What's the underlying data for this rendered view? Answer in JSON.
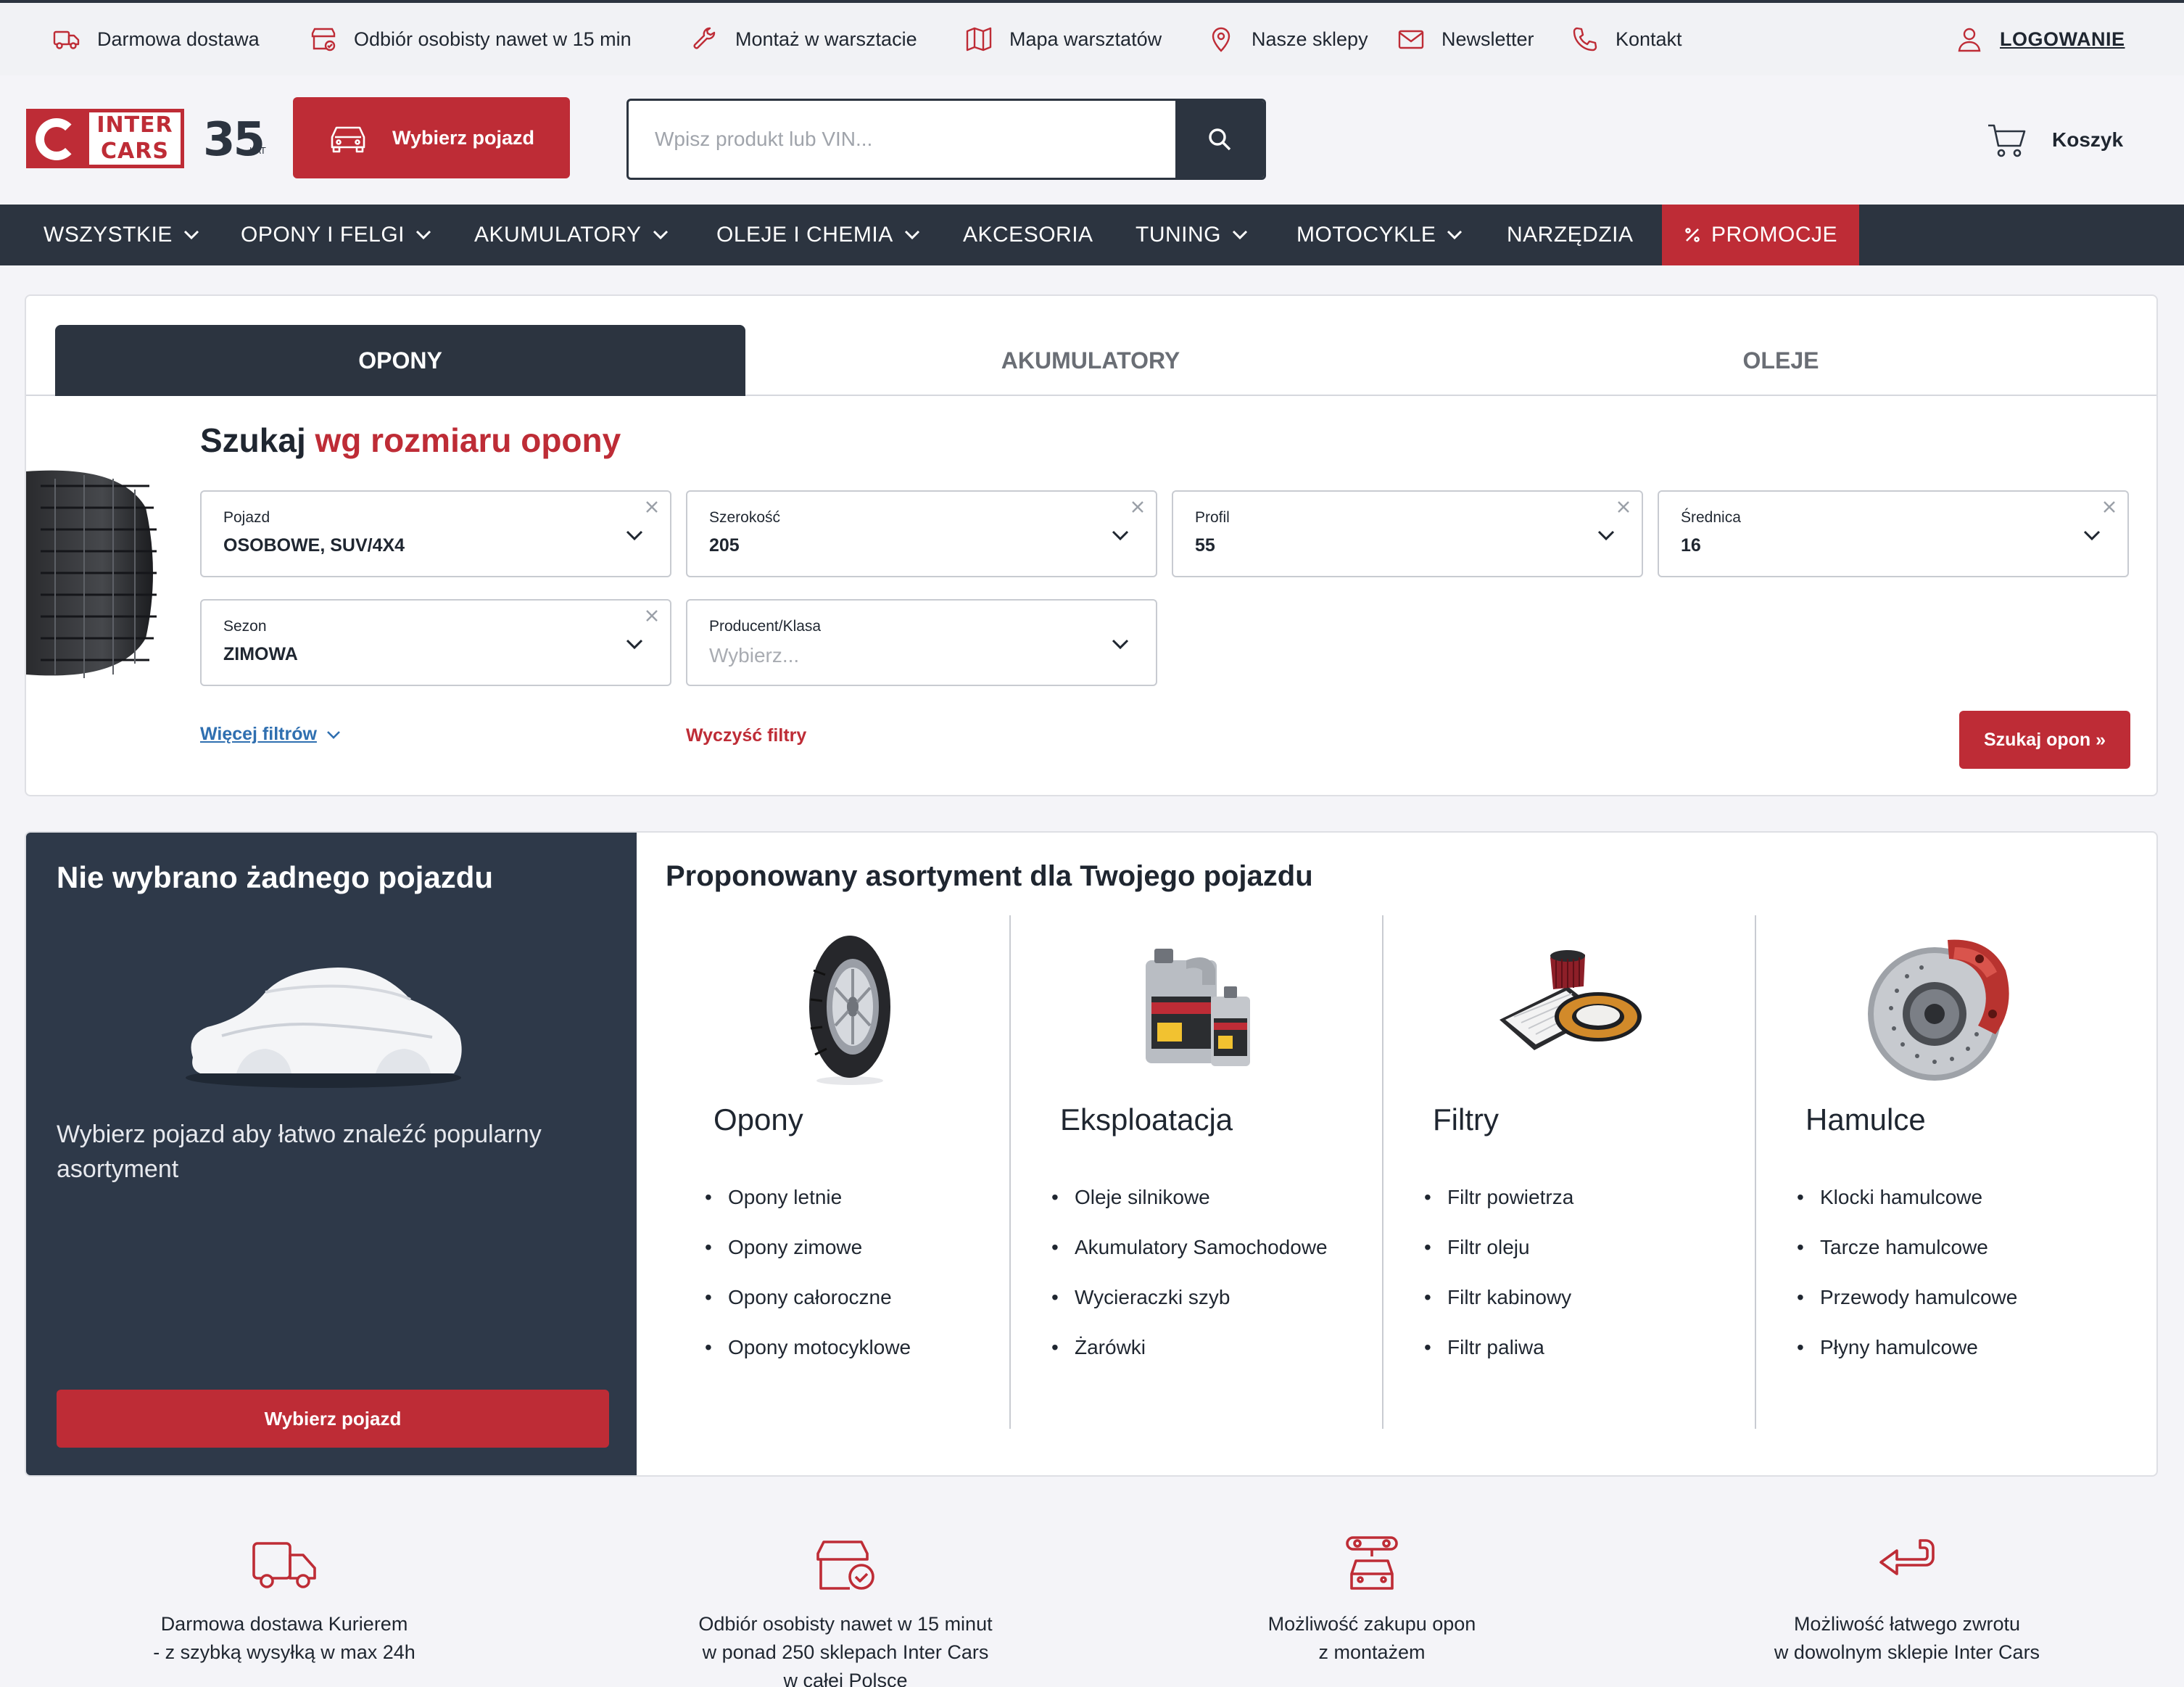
{
  "topbar": {
    "links": [
      "Darmowa dostawa",
      "Odbiór osobisty nawet w 15 min",
      "Montaż w warsztacie",
      "Mapa warsztatów",
      "Nasze sklepy",
      "Newsletter",
      "Kontakt"
    ],
    "login": "LOGOWANIE"
  },
  "header": {
    "logo_text_1": "INTER",
    "logo_text_2": "CARS",
    "anniversary": "35",
    "anniversary_suffix": "LAT",
    "choose_vehicle": "Wybierz pojazd",
    "search_placeholder": "Wpisz produkt lub VIN...",
    "cart": "Koszyk"
  },
  "nav": {
    "items": [
      "WSZYSTKIE",
      "OPONY I FELGI",
      "AKUMULATORY",
      "OLEJE I CHEMIA",
      "AKCESORIA",
      "TUNING",
      "MOTOCYKLE",
      "NARZĘDZIA",
      "PROMOCJE"
    ]
  },
  "search_card": {
    "tabs": [
      "OPONY",
      "AKUMULATORY",
      "OLEJE"
    ],
    "title_part1": "Szukaj",
    "title_part2": "wg rozmiaru opony",
    "fields": [
      {
        "label": "Pojazd",
        "value": "OSOBOWE, SUV/4X4"
      },
      {
        "label": "Szerokość",
        "value": "205"
      },
      {
        "label": "Profil",
        "value": "55"
      },
      {
        "label": "Średnica",
        "value": "16"
      },
      {
        "label": "Sezon",
        "value": "ZIMOWA"
      },
      {
        "label": "Producent/Klasa",
        "placeholder": "Wybierz..."
      }
    ],
    "more_filters": "Więcej filtrów",
    "clear_filters": "Wyczyść filtry",
    "search_button": "Szukaj opon »"
  },
  "vehicle_panel": {
    "title": "Nie wybrano żadnego pojazdu",
    "text": "Wybierz pojazd aby łatwo znaleźć popularny asortyment",
    "button": "Wybierz pojazd"
  },
  "assortment": {
    "title": "Proponowany asortyment dla Twojego pojazdu",
    "categories": [
      {
        "name": "Opony",
        "items": [
          "Opony letnie",
          "Opony zimowe",
          "Opony całoroczne",
          "Opony motocyklowe"
        ]
      },
      {
        "name": "Eksploatacja",
        "items": [
          "Oleje silnikowe",
          "Akumulatory Samochodowe",
          "Wycieraczki szyb",
          "Żarówki"
        ]
      },
      {
        "name": "Filtry",
        "items": [
          "Filtr powietrza",
          "Filtr oleju",
          "Filtr kabinowy",
          "Filtr paliwa"
        ]
      },
      {
        "name": "Hamulce",
        "items": [
          "Klocki hamulcowe",
          "Tarcze hamulcowe",
          "Przewody hamulcowe",
          "Płyny hamulcowe"
        ]
      }
    ]
  },
  "benefits": [
    {
      "lines": [
        "Darmowa dostawa Kurierem",
        "- z szybką wysyłką w max 24h"
      ]
    },
    {
      "lines": [
        "Odbiór osobisty nawet w 15 minut",
        "w ponad 250 sklepach Inter Cars",
        "w całej Polsce"
      ]
    },
    {
      "lines": [
        "Możliwość zakupu opon",
        "z montażem"
      ]
    },
    {
      "lines": [
        "Możliwość łatwego zwrotu",
        "w dowolnym sklepie Inter Cars"
      ]
    }
  ],
  "colors": {
    "brand_red": "#be2c36",
    "dark": "#2c3440",
    "link_blue": "#2f6fb0"
  },
  "icons": [
    "truck-icon",
    "store-check-icon",
    "wrench-icon",
    "map-icon",
    "pin-icon",
    "mail-icon",
    "phone-icon",
    "user-icon",
    "car-icon",
    "mic-icon",
    "search-icon",
    "cart-icon",
    "chevron-down-icon",
    "percent-icon",
    "close-icon",
    "return-arrow-icon"
  ]
}
